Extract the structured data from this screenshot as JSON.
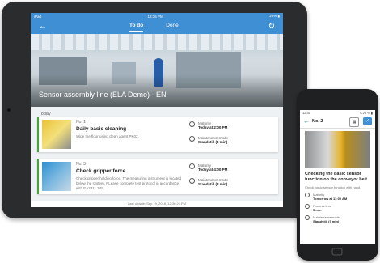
{
  "tablet": {
    "status": {
      "left": "iPad",
      "time": "12:36 PM",
      "battery": "29% ▮"
    },
    "nav": {
      "back_icon": "←",
      "refresh_icon": "↻",
      "tabs": [
        "To do",
        "Done"
      ]
    },
    "hero_title": "Sensor assembly line (ELA Demo) - EN",
    "section": "Today",
    "tasks": [
      {
        "number": "No. 1",
        "title": "Daily basic cleaning",
        "description": "Wipe the floor using clean agent PK02.",
        "maturity_label": "Maturity",
        "maturity_value": "Today at 2:00 PM",
        "maint_label": "Maintenancemode",
        "maint_value": "Standstill (3 min)"
      },
      {
        "number": "No. 3",
        "title": "Check gripper force",
        "description": "Check gripper holding force. The measuring instrument is located below the system. PLease complete test protocol in accordance with EA2311.345.",
        "maturity_label": "Maturity",
        "maturity_value": "Today at 4:00 PM",
        "maint_label": "Maintenancemode",
        "maint_value": "Standstill (3 min)"
      }
    ],
    "footer": "Last update: Sep 19, 2018, 12:36:26 PM"
  },
  "phone": {
    "status": {
      "time": "12:31",
      "battery": "$ 26 % ▮"
    },
    "nav": {
      "back_icon": "←",
      "title": "No. 2",
      "comment_icon": "▤",
      "done_icon": "✓"
    },
    "task_title": "Checking the basic sensor function on the conveyor belt",
    "task_desc": "Check basic sensor function with hand.",
    "meta": [
      {
        "label": "Maturity",
        "value": "Tomorrow at 11:00 AM"
      },
      {
        "label": "Process time",
        "value": "5 min"
      },
      {
        "label": "Maintenancemode",
        "value": "Standstill (3 min)"
      }
    ]
  },
  "colors": {
    "accent": "#3f8fd4",
    "card_border": "#3aaa35"
  }
}
